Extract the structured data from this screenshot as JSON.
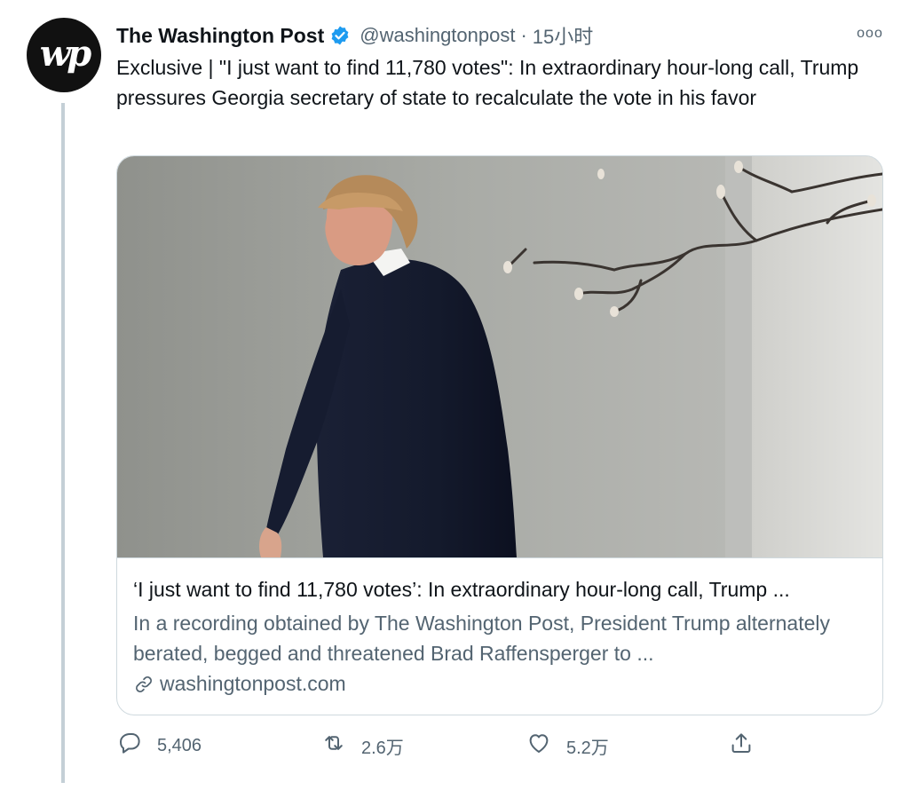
{
  "tweet": {
    "display_name": "The Washington Post",
    "verified": true,
    "handle": "@washingtonpost",
    "separator": "·",
    "time": "15小时",
    "avatar_text": "wp",
    "more_label": "ooo",
    "text": "Exclusive | \"I just want to find 11,780 votes\": In extraordinary hour-long call, Trump pressures Georgia secretary of state to recalculate the vote in his favor"
  },
  "card": {
    "title": "‘I just want to find 11,780 votes’: In extraordinary hour-long call, Trump ...",
    "description": "In a recording obtained by The Washington Post, President Trump alternately berated, begged and threatened Brad Raffensperger to ...",
    "domain": "washingtonpost.com"
  },
  "actions": {
    "reply_count": "5,406",
    "retweet_count": "2.6万",
    "like_count": "5.2万"
  },
  "colors": {
    "verified": "#1d9bf0",
    "secondary_text": "#536471",
    "border": "#cfd9de"
  },
  "icons": [
    "verified-badge-icon",
    "more-icon",
    "link-icon",
    "reply-icon",
    "retweet-icon",
    "like-icon",
    "share-icon"
  ]
}
